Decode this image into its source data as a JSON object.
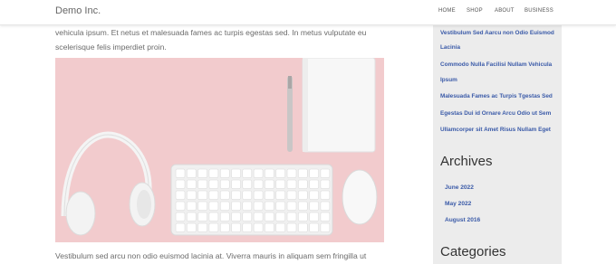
{
  "header": {
    "brand": "Demo Inc.",
    "nav": {
      "home": "HOME",
      "shop": "SHOP",
      "about": "ABOUT",
      "business": "BUSINESS"
    }
  },
  "article": {
    "paragraph_top_line1": "vehicula ipsum. Et netus et malesuada fames ac turpis egestas sed. In metus vulputate eu",
    "paragraph_top_line2": "scelerisque felis imperdiet proin.",
    "image_alt": "Desk with headphones, keyboard, mouse, notebook and pen on pink background",
    "paragraph_bottom": "Vestibulum sed arcu non odio euismod lacinia at. Viverra mauris in aliquam sem fringilla ut"
  },
  "sidebar": {
    "recent_posts": [
      "Vestibulum Sed Aarcu non Odio Euismod",
      "Lacinia",
      "Commodo Nulla Facilisi Nullam Vehicula",
      "Ipsum",
      "Malesuada Fames ac Turpis Tgestas Sed",
      "Egestas Dui id Ornare Arcu Odio ut Sem",
      "Ullamcorper sit Amet Risus Nullam Eget"
    ],
    "archives_title": "Archives",
    "archives": [
      "June 2022",
      "May 2022",
      "August 2016"
    ],
    "categories_title": "Categories"
  },
  "colors": {
    "link": "#3a5aa8",
    "sidebar_bg": "#ececec",
    "photo_bg": "#f2cbcd"
  }
}
